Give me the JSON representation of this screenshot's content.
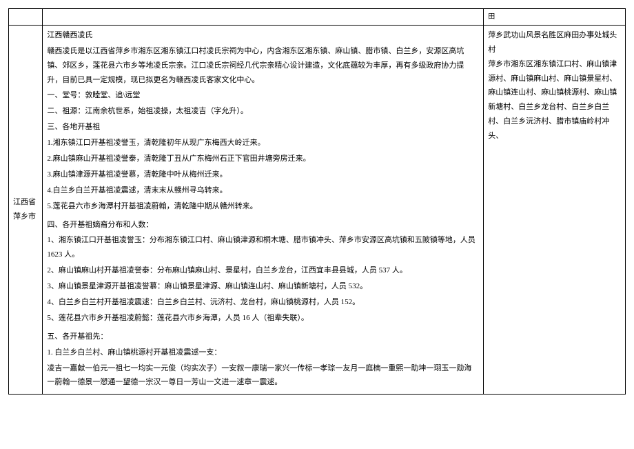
{
  "row1": {
    "col1": "",
    "col2": "",
    "col3_icon": "田"
  },
  "main": {
    "region": "江西省萍乡市",
    "body": {
      "title": "江西赣西凌氏",
      "intro": "赣西凌氏是以江西省萍乡市湘东区湘东镇江口村凌氏宗祠为中心，内含湘东区湘东镇、麻山镇、腊市镇、白兰乡，安源区高坑镇、郊区乡，莲花县六市乡等地凌氏宗亲。江口凌氏宗祠经几代宗亲精心设计建造，文化底蕴较为丰厚，再有多级政府协力提升，目前已具一定规模，现已拟更名为赣西凌氏客家文化中心。",
      "line1": "一、堂号：敦睦堂、追\\远堂",
      "line2": "二、祖源：江南余杭世系，始祖凌操，太祖凌吉（字允升）。",
      "line3": "三、各地开基祖",
      "l3_1": "1.湘东镇江口开基祖凌誉玉，清乾隆初年从现广东梅西大岭迁来。",
      "l3_2": "2.麻山镇麻山开基祖凌誉泰，清乾隆丁丑从广东梅州石正下官田井塘旁房迁来。",
      "l3_3": "3.麻山镇津源开基祖凌誉慕，清乾隆中叶从梅州迁来。",
      "l3_4": "4.白兰乡白兰开基祖凌震逑，清末末从赣州寻乌转来。",
      "l3_5": "5.莲花县六市乡海潭村开基祖凌蔚翰，清乾隆中期从赣州转来。",
      "line4": "四、各开基祖嫡裔分布和人数：",
      "l4_1": "1、湘东镇江口开基祖凌誉玉：分布湘东镇江口村、麻山镇津源和桐木塘、腊市镇冲头、萍乡市安源区高坑镇和五陂镇等地，人员 1623 人。",
      "l4_2": "2、麻山镇麻山村开基祖凌誉泰：分布麻山镇麻山村、景星村，白兰乡龙台，江西宜丰县县城，人员 537 人。",
      "l4_3": "3、麻山镇景星津源开基祖凌誉慕：麻山镇景星津源、麻山镇连山村、麻山镇新塘村，人员 532。",
      "l4_4": "4、白兰乡白兰村开基祖凌震逑：白兰乡白兰村、沅济村、龙台村，麻山镇桃源村，人员 152。",
      "l4_5": "5、莲花县六市乡开基祖凌蔚懿：莲花县六市乡海潭，人员 16 人（祖辈失联）。",
      "line5": "五、各开基祖先：",
      "l5_1": "1. 白兰乡白兰村、麻山镇桃源村开基祖凌震逑一支：",
      "l5_text": "凌吉一嘉献一伯元一祖七一均实一元俊（均实次子）一安叙一康瑞一家兴一传标一孝琮一友月一庭楠一重熙一助坤一珝玉一勋海一蔚翰一德景一愬通一望德一宗汉一尊日一芳山一文进一逑章一震逑。"
    },
    "col3": "萍乡武功山风景名胜区麻田办事处城头村\n萍乡市湘东区湘东镇江口村、麻山镇津源村、麻山镇麻山村、麻山镇景星村、麻山镇连山村、麻山镇桃源村、麻山镇新塘村、白兰乡龙台村、白兰乡白兰村、白兰乡沅济村、腊市镇庙岭村冲头、"
  }
}
